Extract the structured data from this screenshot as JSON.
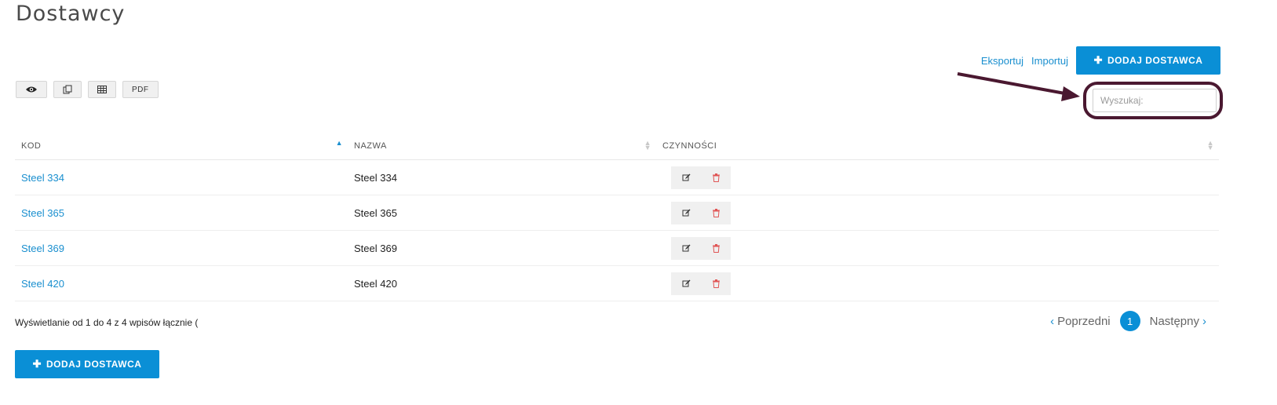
{
  "page": {
    "title": "Dostawcy"
  },
  "header_actions": {
    "export_label": "Eksportuj",
    "import_label": "Importuj",
    "add_label": "DODAJ DOSTAWCA"
  },
  "toolbar": {
    "pdf_label": "PDF",
    "icons": [
      "eye-icon",
      "copy-icon",
      "table-icon"
    ]
  },
  "search": {
    "placeholder": "Wyszukaj:",
    "value": ""
  },
  "table": {
    "columns": [
      "KOD",
      "NAZWA",
      "CZYNNOŚCI"
    ],
    "sorted_column": "KOD",
    "rows": [
      {
        "code": "Steel 334",
        "name": "Steel 334"
      },
      {
        "code": "Steel 365",
        "name": "Steel 365"
      },
      {
        "code": "Steel 369",
        "name": "Steel 369"
      },
      {
        "code": "Steel 420",
        "name": "Steel 420"
      }
    ]
  },
  "footer": {
    "info": "Wyświetlanie od 1 do 4 z 4 wpisów łącznie (",
    "prev_label": "Poprzedni",
    "next_label": "Następny",
    "current_page": "1",
    "add_label": "DODAJ DOSTAWCA"
  },
  "colors": {
    "accent": "#0a8fd6",
    "link": "#1a8fcf",
    "highlight": "#4a1830",
    "delete": "#e05555"
  }
}
